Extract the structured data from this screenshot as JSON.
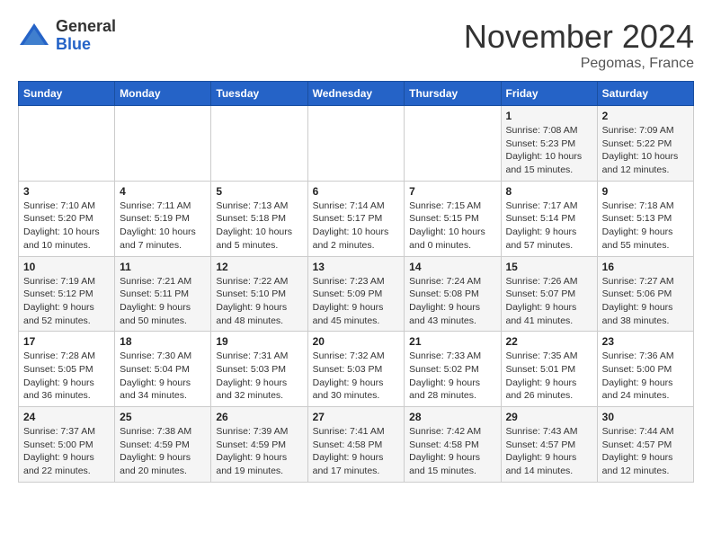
{
  "logo": {
    "general": "General",
    "blue": "Blue"
  },
  "title": "November 2024",
  "location": "Pegomas, France",
  "days_of_week": [
    "Sunday",
    "Monday",
    "Tuesday",
    "Wednesday",
    "Thursday",
    "Friday",
    "Saturday"
  ],
  "weeks": [
    [
      {
        "day": "",
        "info": ""
      },
      {
        "day": "",
        "info": ""
      },
      {
        "day": "",
        "info": ""
      },
      {
        "day": "",
        "info": ""
      },
      {
        "day": "",
        "info": ""
      },
      {
        "day": "1",
        "info": "Sunrise: 7:08 AM\nSunset: 5:23 PM\nDaylight: 10 hours\nand 15 minutes."
      },
      {
        "day": "2",
        "info": "Sunrise: 7:09 AM\nSunset: 5:22 PM\nDaylight: 10 hours\nand 12 minutes."
      }
    ],
    [
      {
        "day": "3",
        "info": "Sunrise: 7:10 AM\nSunset: 5:20 PM\nDaylight: 10 hours\nand 10 minutes."
      },
      {
        "day": "4",
        "info": "Sunrise: 7:11 AM\nSunset: 5:19 PM\nDaylight: 10 hours\nand 7 minutes."
      },
      {
        "day": "5",
        "info": "Sunrise: 7:13 AM\nSunset: 5:18 PM\nDaylight: 10 hours\nand 5 minutes."
      },
      {
        "day": "6",
        "info": "Sunrise: 7:14 AM\nSunset: 5:17 PM\nDaylight: 10 hours\nand 2 minutes."
      },
      {
        "day": "7",
        "info": "Sunrise: 7:15 AM\nSunset: 5:15 PM\nDaylight: 10 hours\nand 0 minutes."
      },
      {
        "day": "8",
        "info": "Sunrise: 7:17 AM\nSunset: 5:14 PM\nDaylight: 9 hours\nand 57 minutes."
      },
      {
        "day": "9",
        "info": "Sunrise: 7:18 AM\nSunset: 5:13 PM\nDaylight: 9 hours\nand 55 minutes."
      }
    ],
    [
      {
        "day": "10",
        "info": "Sunrise: 7:19 AM\nSunset: 5:12 PM\nDaylight: 9 hours\nand 52 minutes."
      },
      {
        "day": "11",
        "info": "Sunrise: 7:21 AM\nSunset: 5:11 PM\nDaylight: 9 hours\nand 50 minutes."
      },
      {
        "day": "12",
        "info": "Sunrise: 7:22 AM\nSunset: 5:10 PM\nDaylight: 9 hours\nand 48 minutes."
      },
      {
        "day": "13",
        "info": "Sunrise: 7:23 AM\nSunset: 5:09 PM\nDaylight: 9 hours\nand 45 minutes."
      },
      {
        "day": "14",
        "info": "Sunrise: 7:24 AM\nSunset: 5:08 PM\nDaylight: 9 hours\nand 43 minutes."
      },
      {
        "day": "15",
        "info": "Sunrise: 7:26 AM\nSunset: 5:07 PM\nDaylight: 9 hours\nand 41 minutes."
      },
      {
        "day": "16",
        "info": "Sunrise: 7:27 AM\nSunset: 5:06 PM\nDaylight: 9 hours\nand 38 minutes."
      }
    ],
    [
      {
        "day": "17",
        "info": "Sunrise: 7:28 AM\nSunset: 5:05 PM\nDaylight: 9 hours\nand 36 minutes."
      },
      {
        "day": "18",
        "info": "Sunrise: 7:30 AM\nSunset: 5:04 PM\nDaylight: 9 hours\nand 34 minutes."
      },
      {
        "day": "19",
        "info": "Sunrise: 7:31 AM\nSunset: 5:03 PM\nDaylight: 9 hours\nand 32 minutes."
      },
      {
        "day": "20",
        "info": "Sunrise: 7:32 AM\nSunset: 5:03 PM\nDaylight: 9 hours\nand 30 minutes."
      },
      {
        "day": "21",
        "info": "Sunrise: 7:33 AM\nSunset: 5:02 PM\nDaylight: 9 hours\nand 28 minutes."
      },
      {
        "day": "22",
        "info": "Sunrise: 7:35 AM\nSunset: 5:01 PM\nDaylight: 9 hours\nand 26 minutes."
      },
      {
        "day": "23",
        "info": "Sunrise: 7:36 AM\nSunset: 5:00 PM\nDaylight: 9 hours\nand 24 minutes."
      }
    ],
    [
      {
        "day": "24",
        "info": "Sunrise: 7:37 AM\nSunset: 5:00 PM\nDaylight: 9 hours\nand 22 minutes."
      },
      {
        "day": "25",
        "info": "Sunrise: 7:38 AM\nSunset: 4:59 PM\nDaylight: 9 hours\nand 20 minutes."
      },
      {
        "day": "26",
        "info": "Sunrise: 7:39 AM\nSunset: 4:59 PM\nDaylight: 9 hours\nand 19 minutes."
      },
      {
        "day": "27",
        "info": "Sunrise: 7:41 AM\nSunset: 4:58 PM\nDaylight: 9 hours\nand 17 minutes."
      },
      {
        "day": "28",
        "info": "Sunrise: 7:42 AM\nSunset: 4:58 PM\nDaylight: 9 hours\nand 15 minutes."
      },
      {
        "day": "29",
        "info": "Sunrise: 7:43 AM\nSunset: 4:57 PM\nDaylight: 9 hours\nand 14 minutes."
      },
      {
        "day": "30",
        "info": "Sunrise: 7:44 AM\nSunset: 4:57 PM\nDaylight: 9 hours\nand 12 minutes."
      }
    ]
  ]
}
